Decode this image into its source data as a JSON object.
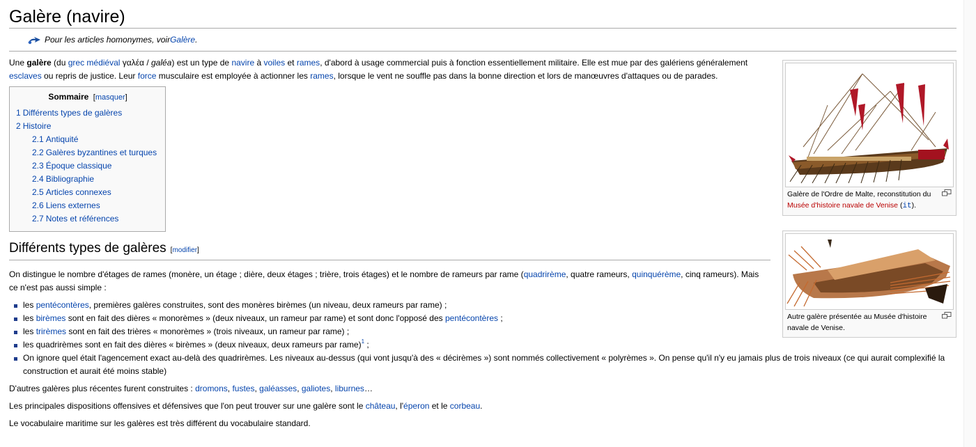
{
  "title": "Galère (navire)",
  "hatnote": {
    "prefix": "Pour les articles homonymes, voir ",
    "link": "Galère",
    "suffix": "."
  },
  "lead": {
    "t1": "Une ",
    "b1": "galère",
    "t2": " (du ",
    "l1": "grec médiéval",
    "t3": " γαλέα / ",
    "i1": "galéa",
    "t4": ") est un type de ",
    "l2": "navire",
    "t5": " à ",
    "l3": "voiles",
    "t6": " et ",
    "l4": "rames",
    "t7": ", d'abord à usage commercial puis à fonction essentiellement militaire. Elle est mue par des galériens généralement ",
    "l5": "esclaves",
    "t8": " ou repris de justice. Leur ",
    "l6": "force",
    "t9": " musculaire est employée à actionner les ",
    "l7": "rames",
    "t10": ", lorsque le vent ne souffle pas dans la bonne direction et lors de manœuvres d'attaques ou de parades."
  },
  "toc": {
    "title": "Sommaire",
    "toggle_open": "[",
    "toggle": "masquer",
    "toggle_close": "]",
    "items": [
      {
        "num": "1",
        "label": "Différents types de galères"
      },
      {
        "num": "2",
        "label": "Histoire"
      },
      {
        "num": "2.1",
        "label": "Antiquité"
      },
      {
        "num": "2.2",
        "label": "Galères byzantines et turques"
      },
      {
        "num": "2.3",
        "label": "Époque classique"
      },
      {
        "num": "2.4",
        "label": "Bibliographie"
      },
      {
        "num": "2.5",
        "label": "Articles connexes"
      },
      {
        "num": "2.6",
        "label": "Liens externes"
      },
      {
        "num": "2.7",
        "label": "Notes et références"
      }
    ]
  },
  "section1": {
    "heading": "Différents types de galères",
    "edit_open": "[",
    "edit": "modifier",
    "edit_close": "]",
    "p1": {
      "t1": "On distingue le nombre d'étages de rames (monère, un étage ; dière, deux étages ; trière, trois étages) et le nombre de rameurs par rame (",
      "l1": "quadrirème",
      "t2": ", quatre rameurs, ",
      "l2": "quinquérème",
      "t3": ", cinq rameurs). Mais ce n'est pas aussi simple :"
    },
    "bullets": {
      "b1": {
        "t1": "les ",
        "l1": "pentécontères",
        "t2": ", premières galères construites, sont des monères birèmes (un niveau, deux rameurs par rame) ;"
      },
      "b2": {
        "t1": "les ",
        "l1": "birèmes",
        "t2": " sont en fait des dières « monorèmes » (deux niveaux, un rameur par rame) et sont donc l'opposé des ",
        "l2": "pentécontères",
        "t3": " ;"
      },
      "b3": {
        "t1": "les ",
        "l1": "trirèmes",
        "t2": " sont en fait des trières « monorèmes » (trois niveaux, un rameur par rame) ;"
      },
      "b4": {
        "t1": "les quadrirèmes sont en fait des dières « birèmes » (deux niveaux, deux rameurs par rame)",
        "sup": "1",
        "t2": " ;"
      },
      "b5": {
        "t1": "On ignore quel était l'agencement exact au-delà des quadrirèmes. Les niveaux au-dessus (qui vont jusqu'à des « décirèmes ») sont nommés collectivement « polyrèmes ». On pense qu'il n'y eu jamais plus de trois niveaux (ce qui aurait complexifié la construction et aurait été moins stable)"
      }
    },
    "p2": {
      "t1": "D'autres galères plus récentes furent construites : ",
      "l1": "dromons",
      "c1": ", ",
      "l2": "fustes",
      "c2": ", ",
      "l3": "galéasses",
      "c3": ", ",
      "l4": "galiotes",
      "c4": ", ",
      "l5": "liburnes",
      "t2": "…"
    },
    "p3": {
      "t1": "Les principales dispositions offensives et défensives que l'on peut trouver sur une galère sont le ",
      "l1": "château",
      "c1": ", l'",
      "l2": "éperon",
      "c2": " et le ",
      "l3": "corbeau",
      "t2": "."
    },
    "p4": "Le vocabulaire maritime sur les galères est très différent du vocabulaire standard."
  },
  "thumb1": {
    "t1": "Galère de l'Ordre de Malte, reconstitution du ",
    "l1": "Musée d'histoire navale de Venise",
    "t2": " (",
    "code": "it",
    "t3": ")."
  },
  "thumb2": {
    "caption": "Autre galère présentée au Musée d'histoire navale de Venise."
  },
  "icons": {
    "hatnote": "disambiguation-icon",
    "magnify": "magnify-icon"
  }
}
